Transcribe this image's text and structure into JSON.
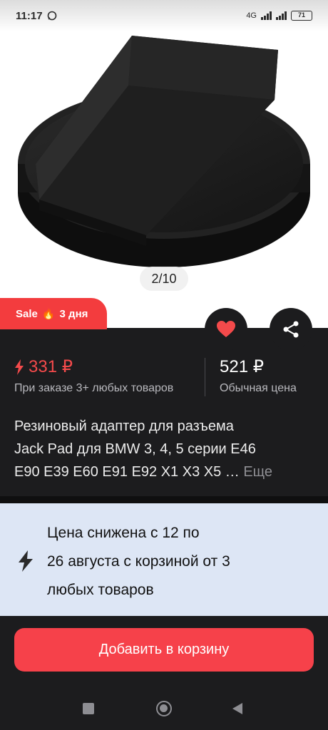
{
  "status_bar": {
    "time": "11:17",
    "network": "4G",
    "battery": "71"
  },
  "gallery": {
    "counter": "2/10"
  },
  "sale_badge": {
    "label": "Sale",
    "flame": "🔥",
    "duration": "3 дня"
  },
  "price": {
    "sale_price": "331 ₽",
    "sale_note": "При заказе 3+ любых товаров",
    "regular_price": "521 ₽",
    "regular_note": "Обычная цена"
  },
  "product": {
    "title_line1": "Резиновый адаптер для разъема",
    "title_line2": "Jack Pad для BMW 3, 4, 5 серии E46",
    "title_line3": "E90 E39 E60 E91 E92 X1 X3 X5 …",
    "more_label": "Еще"
  },
  "promo": {
    "line1": "Цена снижена с 12 по",
    "line2": "26 августа с корзиной от 3",
    "line3": "любых товаров"
  },
  "actions": {
    "add_to_cart": "Добавить в корзину"
  },
  "colors": {
    "accent": "#f6414a",
    "sale_red": "#f44a4b",
    "dark_bg": "#1c1c1e",
    "promo_bg": "#dde6f5"
  },
  "icons": {
    "back": "arrow-left-icon",
    "favorite": "heart-icon",
    "share": "share-icon",
    "lightning": "lightning-icon"
  }
}
